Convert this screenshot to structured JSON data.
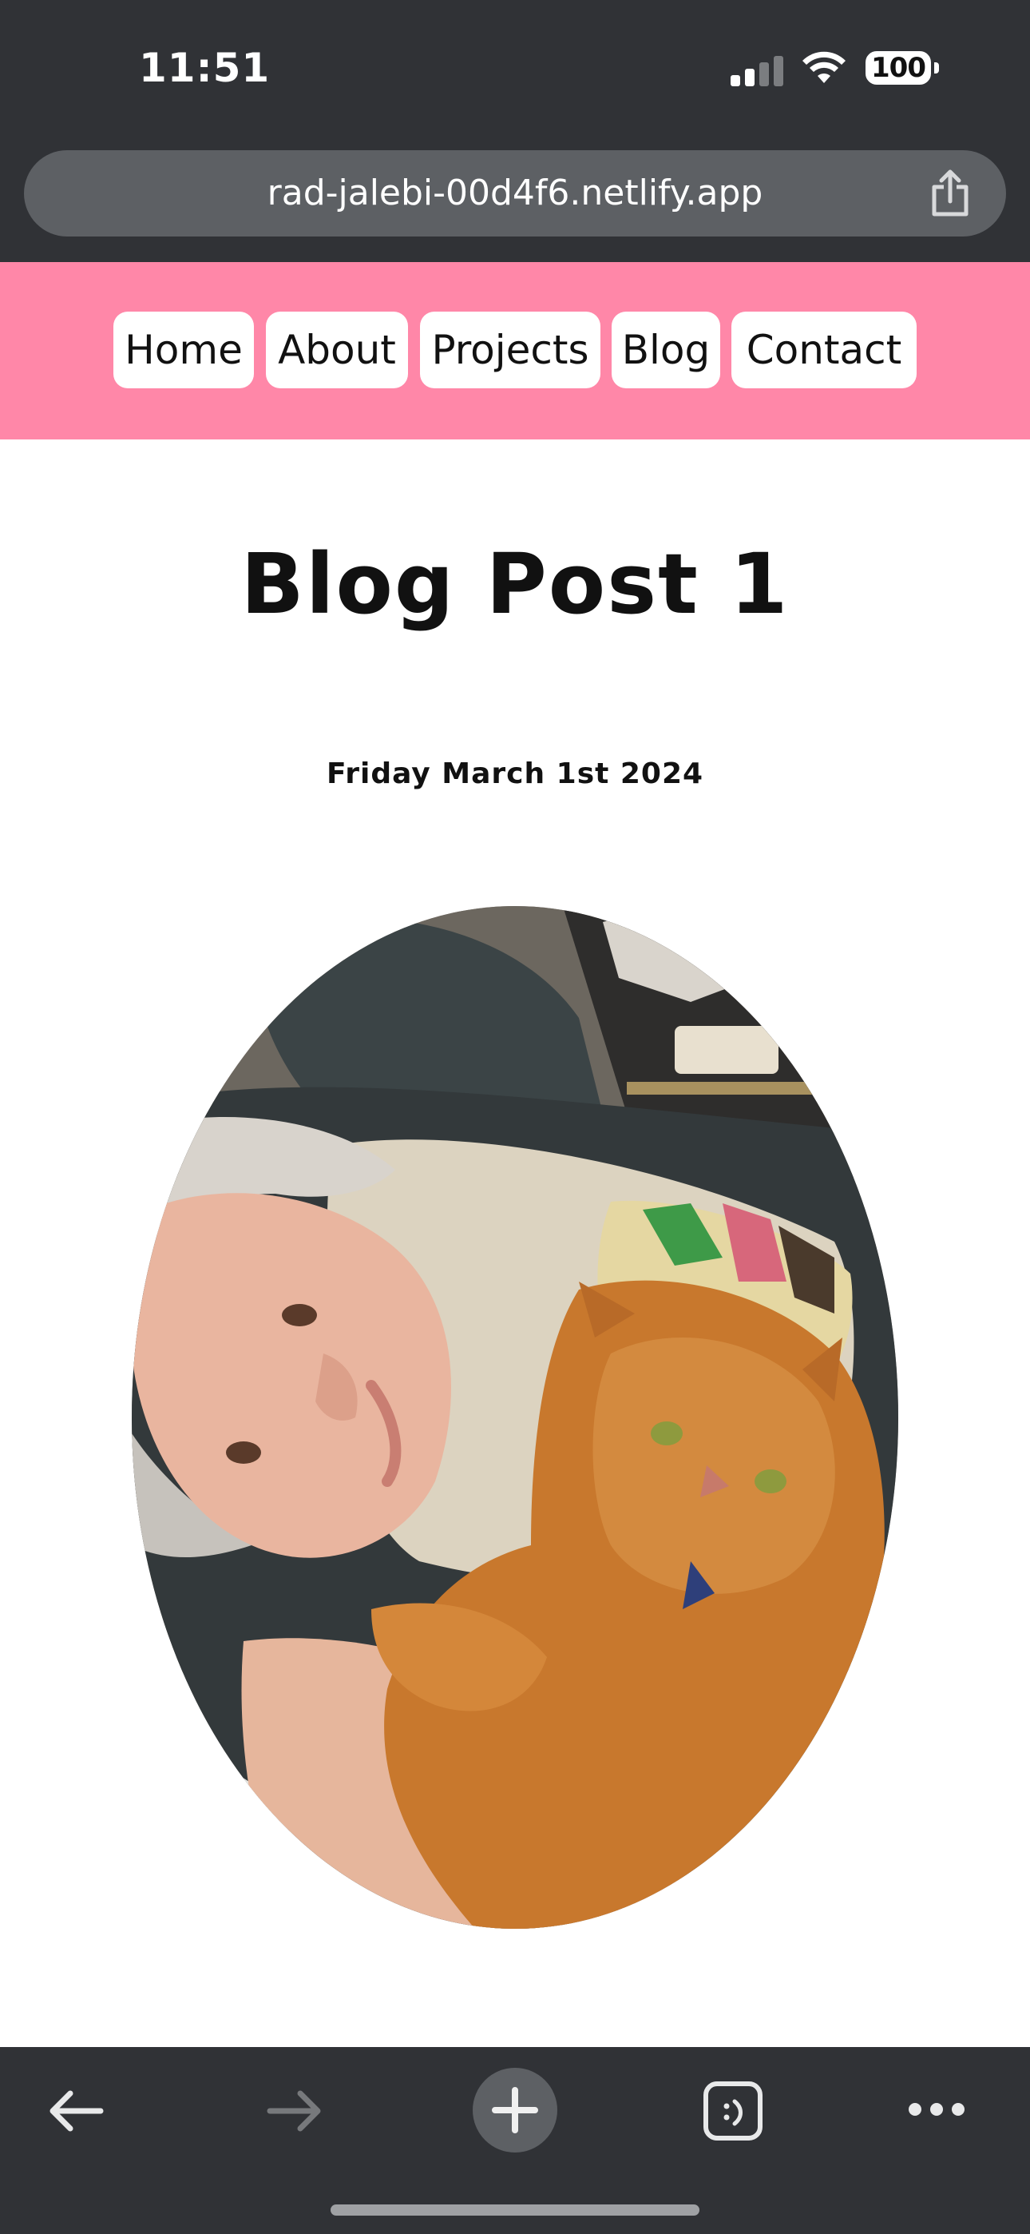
{
  "status_bar": {
    "time": "11:51",
    "battery": "100"
  },
  "browser": {
    "url": "rad-jalebi-00d4f6.netlify.app"
  },
  "nav": {
    "items": [
      {
        "label": "Home"
      },
      {
        "label": "About"
      },
      {
        "label": "Projects"
      },
      {
        "label": "Blog"
      },
      {
        "label": "Contact"
      }
    ]
  },
  "post": {
    "title": "Blog Post 1",
    "date": "Friday March 1st 2024"
  },
  "toolbar": {
    "icons": [
      "back-arrow-icon",
      "forward-arrow-icon",
      "new-tab-plus-icon",
      "tabs-icon",
      "more-icon"
    ]
  },
  "colors": {
    "chrome": "#303236",
    "url_bar": "#5d6064",
    "nav_background": "#ff87a8",
    "nav_button": "#ffffff"
  }
}
